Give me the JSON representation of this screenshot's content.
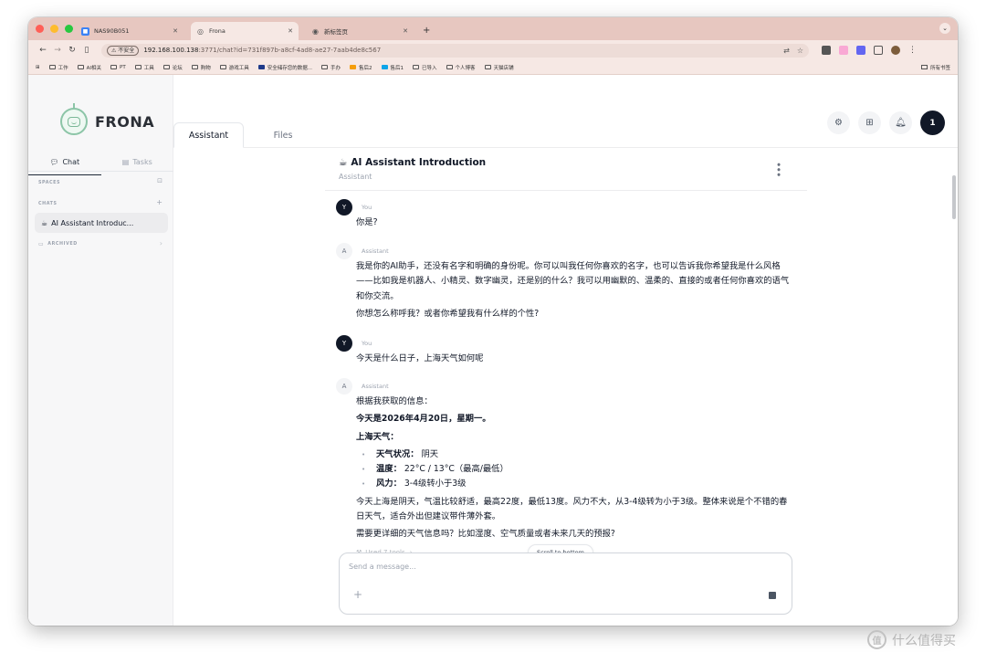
{
  "browser": {
    "tabs": [
      {
        "title": "NAS90B051",
        "icon_color": "#3b82f6",
        "active": false
      },
      {
        "title": "Frona",
        "icon_color": "#6b7280",
        "active": true
      },
      {
        "title": "新标签页",
        "icon_color": "#6b7280",
        "active": false
      }
    ],
    "new_tab": "+",
    "url_insecure": "不安全",
    "url_host": "192.168.100.138",
    "url_path": ":3771/chat?id=731f897b-a8cf-4ad8-ae27-7aab4de8c567",
    "bookmarks": [
      "工作",
      "AI相关",
      "PT",
      "工具",
      "论坛",
      "购物",
      "游戏工具",
      "安全储存您的数据...",
      "手办",
      "售后2",
      "售后1",
      "已导入",
      "个人博客",
      "天猫店铺"
    ],
    "bookmarks_all": "所有书签"
  },
  "app": {
    "name": "FRONA",
    "accent": "#8cc5a7",
    "sidebar": {
      "tabs": [
        {
          "label": "Chat",
          "icon": "chat-bubble-icon"
        },
        {
          "label": "Tasks",
          "icon": "clipboard-icon"
        }
      ],
      "spaces_label": "SPACES",
      "chats_label": "CHATS",
      "chats": [
        {
          "title": "AI Assistant Introduc...",
          "icon": "cup-icon"
        }
      ],
      "archived_label": "ARCHIVED"
    },
    "main_tabs": [
      {
        "label": "Assistant"
      },
      {
        "label": "Files"
      }
    ],
    "user_badge": "1"
  },
  "conversation": {
    "title": "AI Assistant Introduction",
    "subtitle": "Assistant",
    "messages": [
      {
        "role": "You",
        "avatar": "Y",
        "text": "你是?"
      },
      {
        "role": "Assistant",
        "avatar": "A",
        "p1": "我是你的AI助手，还没有名字和明确的身份呢。你可以叫我任何你喜欢的名字，也可以告诉我你希望我是什么风格——比如我是机器人、小精灵、数字幽灵，还是别的什么？我可以用幽默的、温柔的、直接的或者任何你喜欢的语气和你交流。",
        "p2": "你想怎么称呼我？或者你希望我有什么样的个性?"
      },
      {
        "role": "You",
        "avatar": "Y",
        "text": "今天是什么日子，上海天气如何呢"
      },
      {
        "role": "Assistant",
        "avatar": "A",
        "intro": "根据我获取的信息：",
        "date_line": "今天是2026年4月20日，星期一。",
        "weather_heading": "上海天气：",
        "items": [
          {
            "label": "天气状况：",
            "value": "阴天"
          },
          {
            "label": "温度：",
            "value": "22°C / 13°C（最高/最低）"
          },
          {
            "label": "风力：",
            "value": "3-4级转小于3级"
          }
        ],
        "summary": "今天上海是阴天，气温比较舒适，最高22度，最低13度。风力不大，从3-4级转为小于3级。整体来说是个不错的春日天气，适合外出但建议带件薄外套。",
        "followup": "需要更详细的天气信息吗？比如湿度、空气质量或者未来几天的预报?",
        "tools": "Used 7 tools"
      }
    ],
    "scroll_to_bottom": "Scroll to bottom",
    "composer_placeholder": "Send a message..."
  },
  "watermark": "什么值得买"
}
